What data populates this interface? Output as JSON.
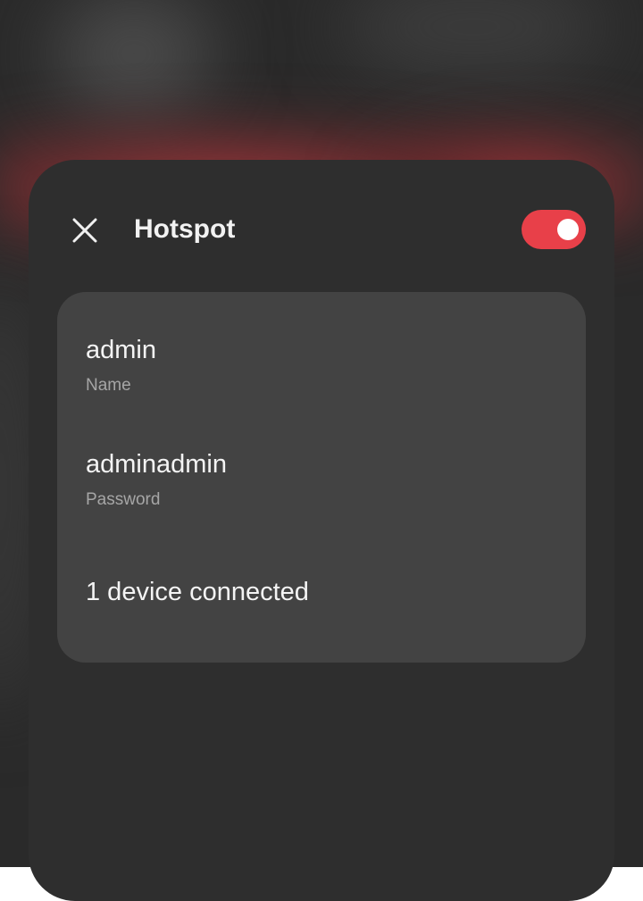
{
  "header": {
    "title": "Hotspot",
    "close_icon": "close-icon",
    "toggle": {
      "state": "on",
      "accent_color": "#e84049"
    }
  },
  "card": {
    "name": {
      "value": "admin",
      "label": "Name"
    },
    "password": {
      "value": "adminadmin",
      "label": "Password"
    },
    "devices_text": "1 device connected"
  },
  "colors": {
    "panel": "#2e2e2e",
    "card": "#434343",
    "accent": "#e84049"
  }
}
